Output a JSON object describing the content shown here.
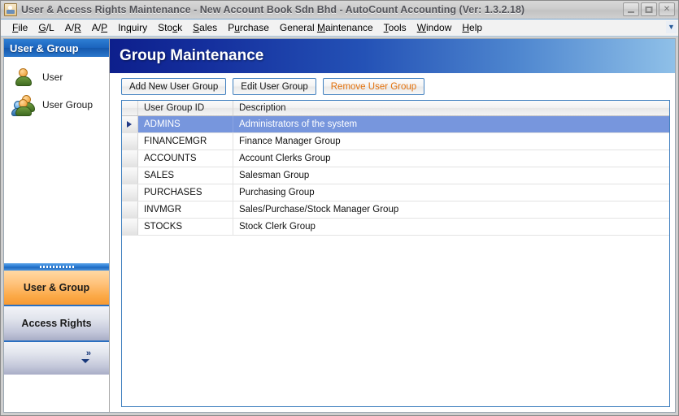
{
  "window": {
    "title": "User & Access Rights Maintenance - New Account Book Sdn Bhd - AutoCount Accounting (Ver: 1.3.2.18)",
    "icon": "app-icon",
    "controls": {
      "minimize": "_",
      "maximize": "□",
      "close": "✕"
    }
  },
  "menubar": {
    "items": [
      {
        "label": "File",
        "accel": "F"
      },
      {
        "label": "G/L",
        "accel": "G"
      },
      {
        "label": "A/R",
        "accel": "R"
      },
      {
        "label": "A/P",
        "accel": "P"
      },
      {
        "label": "Inquiry",
        "accel": "q"
      },
      {
        "label": "Stock",
        "accel": "c"
      },
      {
        "label": "Sales",
        "accel": "S"
      },
      {
        "label": "Purchase",
        "accel": "u"
      },
      {
        "label": "General",
        "accel": ""
      },
      {
        "label": "Maintenance",
        "accel": "M"
      },
      {
        "label": "Tools",
        "accel": "T"
      },
      {
        "label": "Window",
        "accel": "W"
      },
      {
        "label": "Help",
        "accel": "H"
      }
    ],
    "overflow_icon": "chevron-down-icon"
  },
  "sidebar": {
    "header": "User & Group",
    "items": [
      {
        "label": "User",
        "icon": "user-icon"
      },
      {
        "label": "User Group",
        "icon": "user-group-icon"
      }
    ],
    "nav": [
      {
        "label": "User & Group",
        "active": true
      },
      {
        "label": "Access Rights",
        "active": false
      }
    ],
    "more": {
      "chevron": "»",
      "icon": "double-chevron-right-icon"
    }
  },
  "main": {
    "page_title": "Group Maintenance",
    "toolbar": {
      "add_label": "Add New User Group",
      "edit_label": "Edit User Group",
      "remove_label": "Remove User Group",
      "remove_color": "#e2700a"
    },
    "grid": {
      "columns": [
        "User Group ID",
        "Description"
      ],
      "selected_row_index": 0,
      "selection_color": "#7796dd",
      "rows": [
        {
          "id": "ADMINS",
          "description": "Administrators of the system"
        },
        {
          "id": "FINANCEMGR",
          "description": "Finance Manager Group"
        },
        {
          "id": "ACCOUNTS",
          "description": "Account Clerks Group"
        },
        {
          "id": "SALES",
          "description": "Salesman Group"
        },
        {
          "id": "PURCHASES",
          "description": "Purchasing Group"
        },
        {
          "id": "INVMGR",
          "description": "Sales/Purchase/Stock Manager Group"
        },
        {
          "id": "STOCKS",
          "description": "Stock Clerk Group"
        }
      ]
    }
  }
}
